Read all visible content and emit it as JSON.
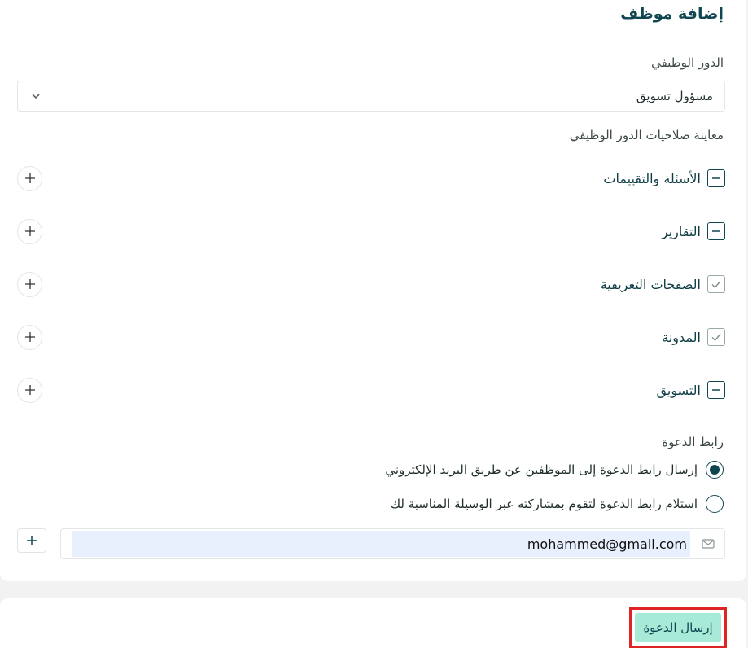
{
  "form": {
    "title": "إضافة موظف",
    "role_label": "الدور الوظيفي",
    "role_value": "مسؤول تسويق",
    "permissions_label": "معاينة صلاحيات الدور الوظيفي",
    "permissions": [
      {
        "label": "الأسئلة والتقييمات",
        "state": "partial"
      },
      {
        "label": "التقارير",
        "state": "partial"
      },
      {
        "label": "الصفحات التعريفية",
        "state": "checked"
      },
      {
        "label": "المدونة",
        "state": "checked"
      },
      {
        "label": "التسويق",
        "state": "partial"
      }
    ],
    "invite_label": "رابط الدعوة",
    "invite_options": [
      {
        "label": "إرسال رابط الدعوة إلى الموظفين عن طريق البريد الإلكتروني",
        "selected": true
      },
      {
        "label": "استلام رابط الدعوة لتقوم بمشاركته عبر الوسيلة المناسبة لك",
        "selected": false
      }
    ],
    "email_value": "mohammed@gmail.com",
    "send_label": "إرسال الدعوة"
  },
  "colors": {
    "primary": "#0f4650",
    "send_bg": "#a8ead8",
    "highlight": "#e02424",
    "autofill": "#e8f0fe"
  }
}
